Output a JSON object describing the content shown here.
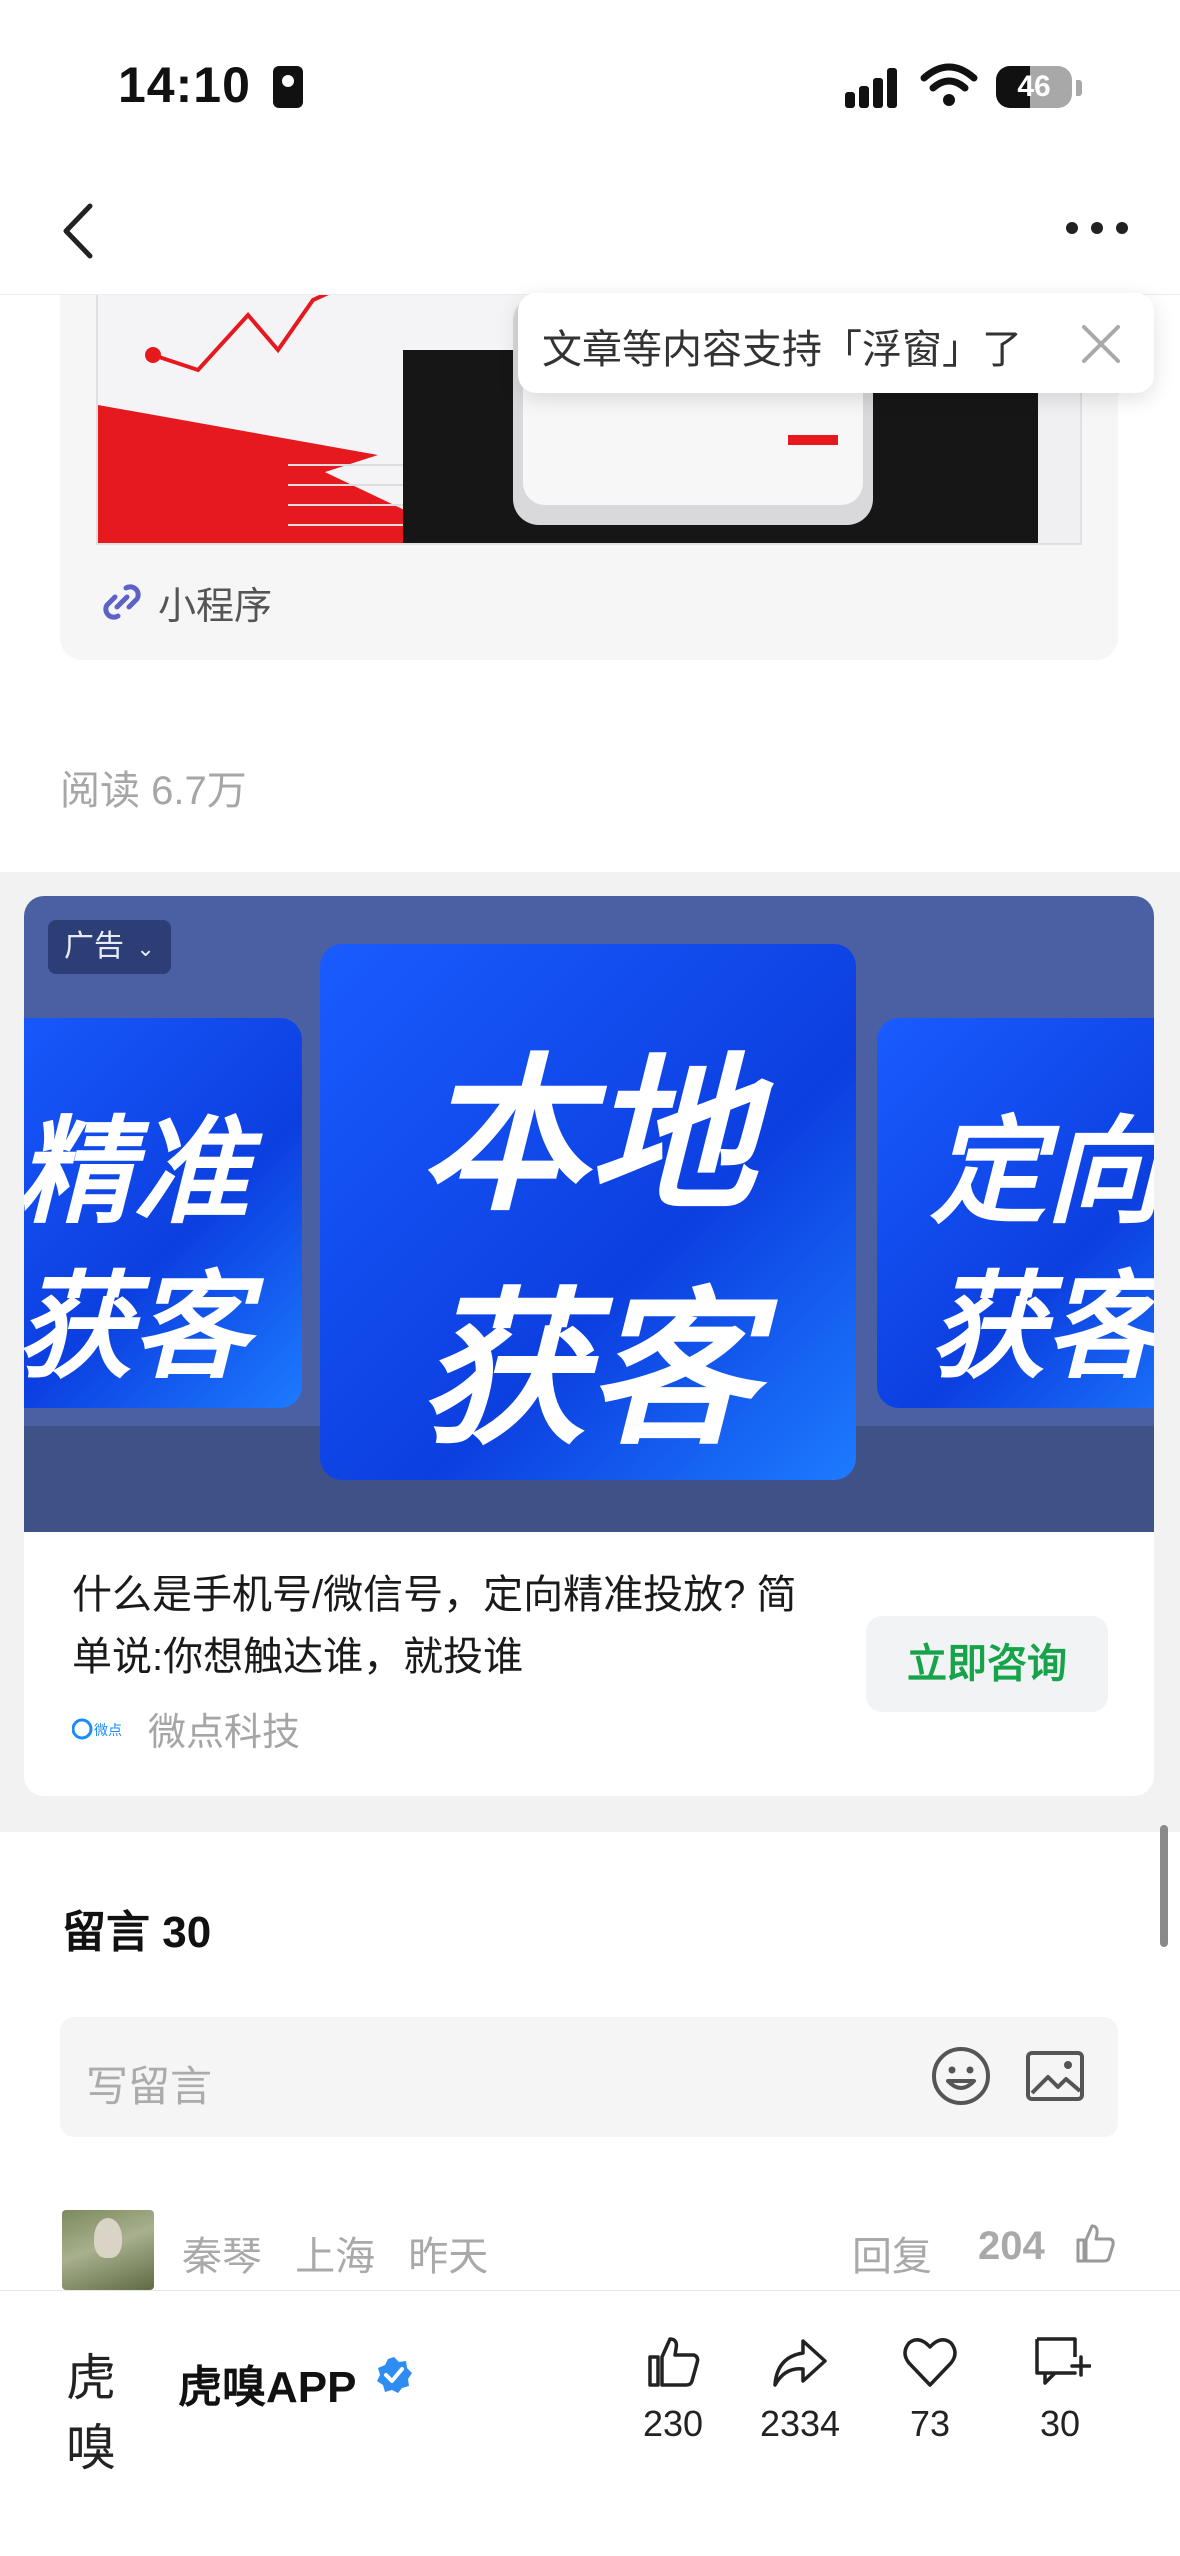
{
  "status_bar": {
    "time": "14:10",
    "battery": "46"
  },
  "mini_program": {
    "label": "小程序"
  },
  "float_tip": {
    "text": "文章等内容支持「浮窗」了"
  },
  "article": {
    "read_count": "阅读 6.7万"
  },
  "ad": {
    "tag": "广告",
    "tiles": [
      {
        "line1": "精准",
        "line2": "获客"
      },
      {
        "line1": "本地",
        "line2": "获客"
      },
      {
        "line1": "定向",
        "line2": "获客"
      }
    ],
    "title": "什么是手机号/微信号，定向精准投放? 简单说:你想触达谁，就投谁",
    "cta": "立即咨询",
    "advertiser": "微点科技",
    "advertiser_logo_text": "微点",
    "colors": {
      "banner": "#4b5fa3",
      "tile": "#1a5cff",
      "cta_text": "#16a34a"
    }
  },
  "comments": {
    "title": "留言 30",
    "input_placeholder": "写留言",
    "items": [
      {
        "user": "秦琴",
        "location": "上海",
        "time": "昨天",
        "reply": "回复",
        "likes": "204"
      }
    ]
  },
  "bottom_bar": {
    "account_logo": "虎嗅",
    "account_name": "虎嗅APP",
    "actions": [
      {
        "icon": "thumbs-up-icon",
        "count": "230"
      },
      {
        "icon": "share-icon",
        "count": "2334"
      },
      {
        "icon": "heart-icon",
        "count": "73"
      },
      {
        "icon": "comment-add-icon",
        "count": "30"
      }
    ]
  }
}
